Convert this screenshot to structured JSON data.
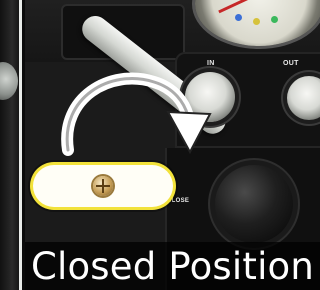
{
  "panel_labels": {
    "in": "IN",
    "out": "OUT",
    "close": "CLOSE"
  },
  "caption": {
    "text": "Closed Position"
  },
  "colors": {
    "lever_outline": "#f2e23a",
    "arrow": "#ffffff",
    "panel": "#1b1b1b"
  },
  "icons": {
    "arrow": "curved-arrow-icon",
    "screw": "screw-icon"
  }
}
